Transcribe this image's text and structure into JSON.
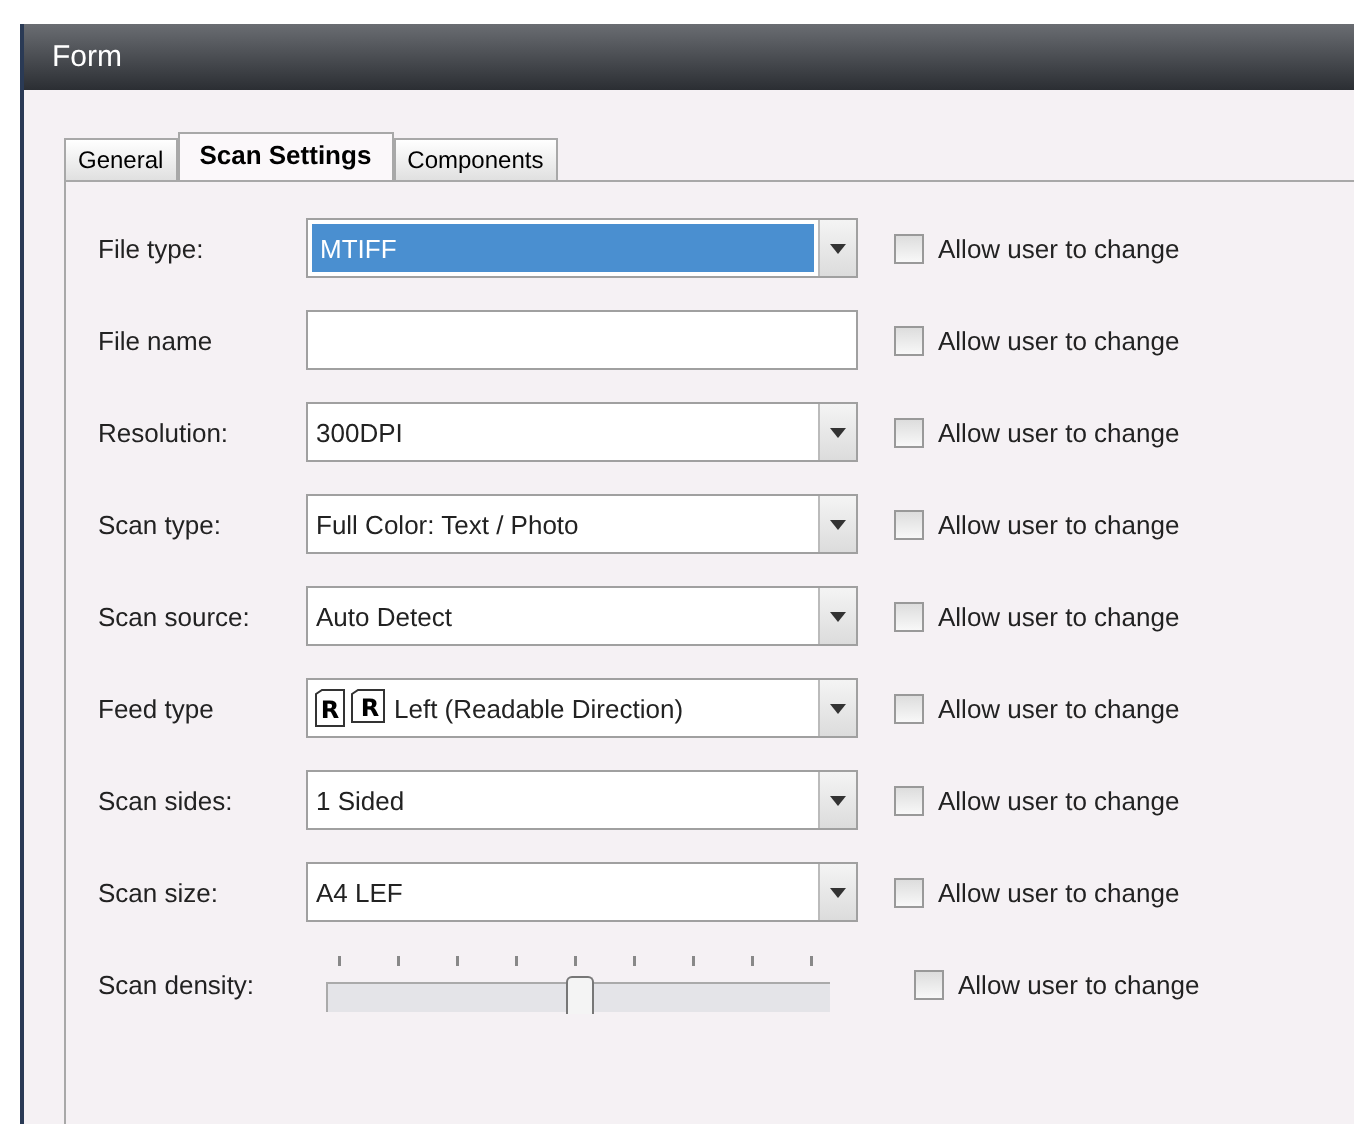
{
  "window": {
    "title": "Form"
  },
  "tabs": [
    {
      "label": "General",
      "selected": false
    },
    {
      "label": "Scan Settings",
      "selected": true
    },
    {
      "label": "Components",
      "selected": false
    }
  ],
  "rows": [
    {
      "kind": "dropdown",
      "label": "File type:",
      "value": "MTIFF",
      "highlighted": true,
      "allow_label": "Allow user to change",
      "checked": false
    },
    {
      "kind": "text",
      "label": "File name",
      "value": "",
      "allow_label": "Allow user to change",
      "checked": false
    },
    {
      "kind": "dropdown",
      "label": "Resolution:",
      "value": "300DPI",
      "highlighted": false,
      "allow_label": "Allow user to change",
      "checked": false
    },
    {
      "kind": "dropdown",
      "label": "Scan type:",
      "value": "Full Color: Text / Photo",
      "highlighted": false,
      "allow_label": "Allow user to change",
      "checked": false
    },
    {
      "kind": "dropdown",
      "label": "Scan source:",
      "value": "Auto Detect",
      "highlighted": false,
      "allow_label": "Allow user to change",
      "checked": false
    },
    {
      "kind": "feed",
      "label": "Feed type",
      "value": "Left (Readable Direction)",
      "icon_letters": [
        "R",
        "R"
      ],
      "highlighted": false,
      "allow_label": "Allow user to change",
      "checked": false
    },
    {
      "kind": "dropdown",
      "label": "Scan sides:",
      "value": "1 Sided",
      "highlighted": false,
      "allow_label": "Allow user to change",
      "checked": false
    },
    {
      "kind": "dropdown",
      "label": "Scan size:",
      "value": "A4 LEF",
      "highlighted": false,
      "allow_label": "Allow user to change",
      "checked": false
    },
    {
      "kind": "slider",
      "label": "Scan density:",
      "level": 0.5,
      "allow_label": "Allow user to change",
      "checked": false
    }
  ]
}
